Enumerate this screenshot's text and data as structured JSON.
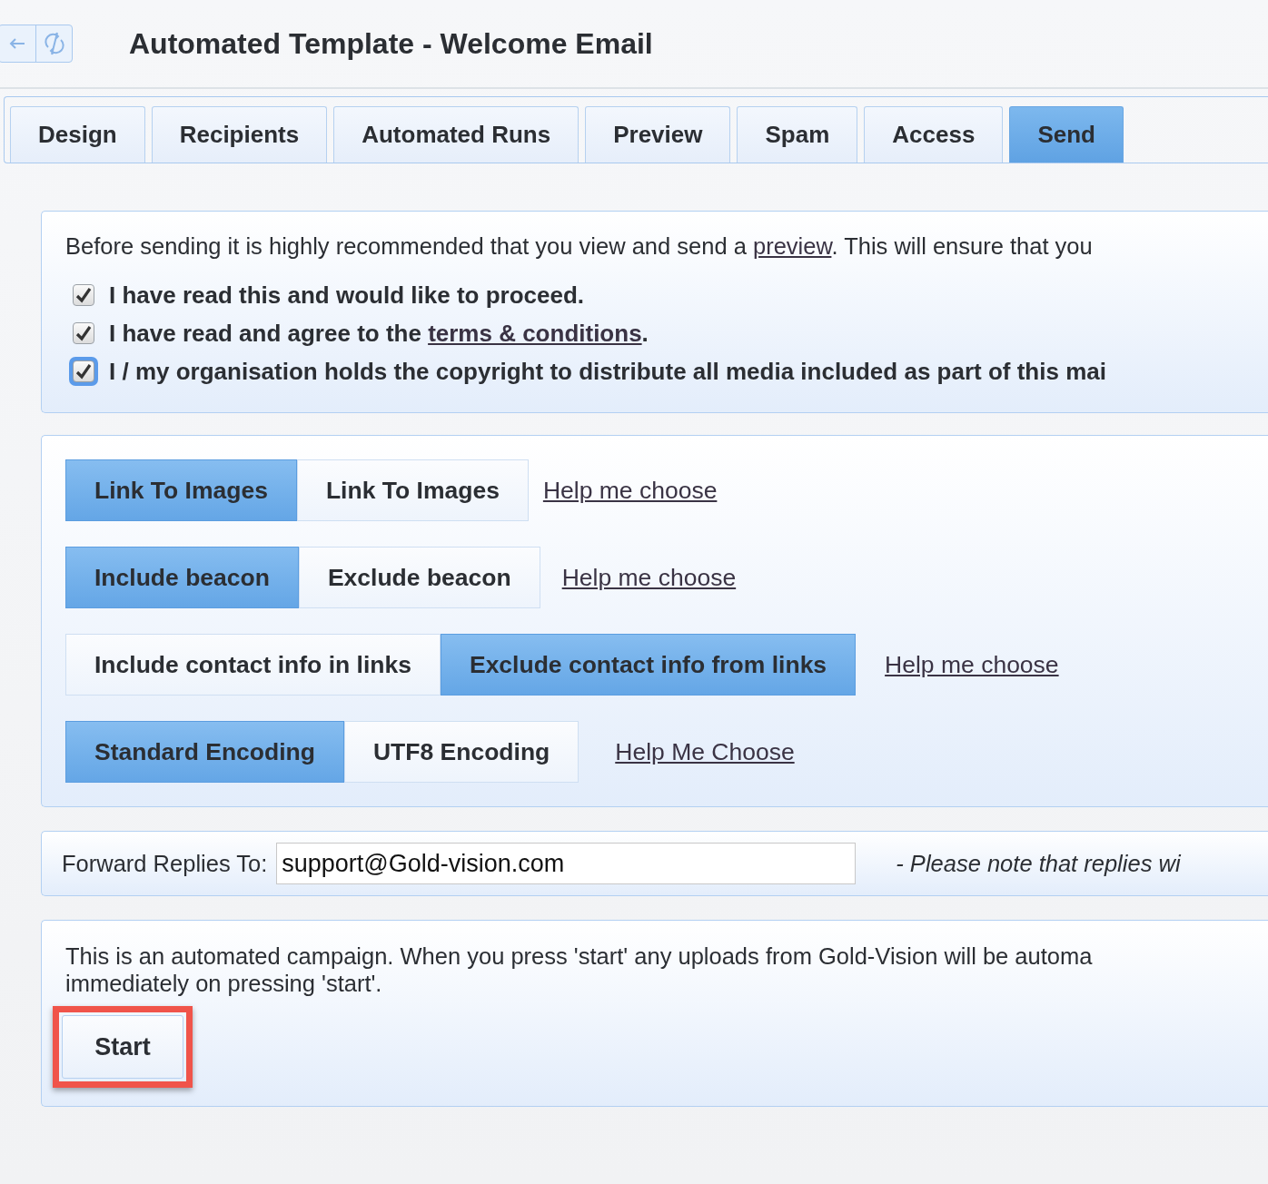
{
  "window": {
    "title": "Automated Template - Welcome Email"
  },
  "tabs": [
    {
      "label": "Design",
      "selected": false
    },
    {
      "label": "Recipients",
      "selected": false
    },
    {
      "label": "Automated Runs",
      "selected": false
    },
    {
      "label": "Preview",
      "selected": false
    },
    {
      "label": "Spam",
      "selected": false
    },
    {
      "label": "Access",
      "selected": false
    },
    {
      "label": "Send",
      "selected": true
    }
  ],
  "notice": {
    "before": "Before sending it is highly recommended that you view and send a ",
    "link": "preview",
    "after": ". This will ensure that you"
  },
  "confirmations": [
    {
      "label": "I have read this and would like to proceed.",
      "checked": true,
      "focused": false
    },
    {
      "label": "I have read and agree to the ",
      "link": "terms & conditions",
      "after": ".",
      "checked": true,
      "focused": false
    },
    {
      "label": "I / my organisation holds the copyright to distribute all media included as part of this mai",
      "checked": true,
      "focused": true
    }
  ],
  "options": [
    {
      "choices": [
        {
          "label": "Link To Images",
          "selected": true
        },
        {
          "label": "Link To Images",
          "selected": false
        }
      ],
      "help": "Help me choose"
    },
    {
      "choices": [
        {
          "label": "Include beacon",
          "selected": true
        },
        {
          "label": "Exclude beacon",
          "selected": false
        }
      ],
      "help": "Help me choose"
    },
    {
      "choices": [
        {
          "label": "Include contact info in links",
          "selected": false
        },
        {
          "label": "Exclude contact info from links",
          "selected": true
        }
      ],
      "help": "Help me choose"
    },
    {
      "choices": [
        {
          "label": "Standard Encoding",
          "selected": true
        },
        {
          "label": "UTF8 Encoding",
          "selected": false
        }
      ],
      "help": "Help Me Choose"
    }
  ],
  "forward": {
    "label": "Forward Replies To:",
    "value": "support@Gold-vision.com",
    "note": "- Please note that replies wi"
  },
  "start": {
    "lines": [
      "This is an automated campaign. When you press 'start' any uploads from Gold-Vision will be automa",
      "immediately on pressing 'start'."
    ],
    "button": "Start",
    "highlighted": true
  }
}
